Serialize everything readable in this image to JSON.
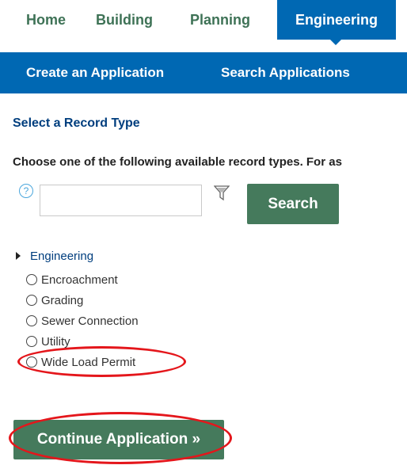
{
  "top_tabs": {
    "home": "Home",
    "building": "Building",
    "planning": "Planning",
    "engineering": "Engineering",
    "active": "Engineering"
  },
  "subnav": {
    "create": "Create an Application",
    "search": "Search Applications"
  },
  "section_title": "Select a Record Type",
  "instructions": "Choose one of the following available record types. For as",
  "search": {
    "help_icon": "?",
    "input_value": "",
    "button_label": "Search",
    "filter_icon": "filter-icon"
  },
  "tree": {
    "group_label": "Engineering",
    "items": [
      {
        "label": "Encroachment"
      },
      {
        "label": "Grading"
      },
      {
        "label": "Sewer Connection"
      },
      {
        "label": "Utility"
      },
      {
        "label": "Wide Load Permit"
      }
    ]
  },
  "continue_label": "Continue Application »",
  "colors": {
    "brand_blue": "#0068b3",
    "brand_green": "#457a5c",
    "tab_text_green": "#3e7256",
    "heading_blue": "#003e7e",
    "annotation_red": "#e4161b"
  }
}
